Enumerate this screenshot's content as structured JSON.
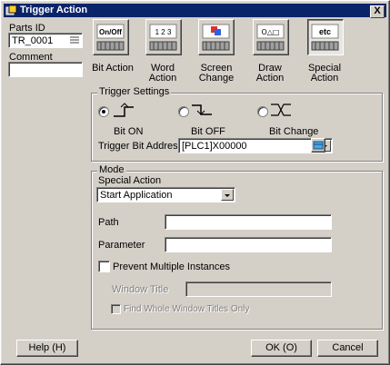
{
  "window": {
    "title": "Trigger Action",
    "close_glyph": "X"
  },
  "parts": {
    "parts_id_label": "Parts ID",
    "parts_id_value": "TR_0001",
    "comment_label": "Comment",
    "comment_value": ""
  },
  "actions": [
    {
      "icon_text": "On/Off",
      "label_line1": "Bit Action",
      "label_line2": "",
      "selected": false
    },
    {
      "icon_text": "1 2 3",
      "label_line1": "Word",
      "label_line2": "Action",
      "selected": false
    },
    {
      "icon_text": "",
      "label_line1": "Screen",
      "label_line2": "Change",
      "selected": false
    },
    {
      "icon_text": "O△□",
      "label_line1": "Draw",
      "label_line2": "Action",
      "selected": false
    },
    {
      "icon_text": "etc",
      "label_line1": "Special",
      "label_line2": "Action",
      "selected": true
    }
  ],
  "trigger": {
    "group_title": "Trigger Settings",
    "bit_on": "Bit ON",
    "bit_off": "Bit OFF",
    "bit_change": "Bit Change",
    "selected": "Bit ON",
    "address_label": "Trigger Bit Address",
    "address_value": "[PLC1]X00000"
  },
  "mode": {
    "group_title": "Mode",
    "special_action_label": "Special Action",
    "special_action_value": "Start Application",
    "path_label": "Path",
    "path_value": "",
    "parameter_label": "Parameter",
    "parameter_value": "",
    "prevent_label": "Prevent Multiple Instances",
    "prevent_checked": false,
    "window_title_label": "Window Title",
    "window_title_value": "",
    "find_whole_label": "Find Whole Window Titles Only",
    "find_whole_checked": false
  },
  "buttons": {
    "help": "Help (H)",
    "ok": "OK (O)",
    "cancel": "Cancel"
  },
  "colors": {
    "titlebar": "#0a246a",
    "face": "#d4d0c8"
  }
}
